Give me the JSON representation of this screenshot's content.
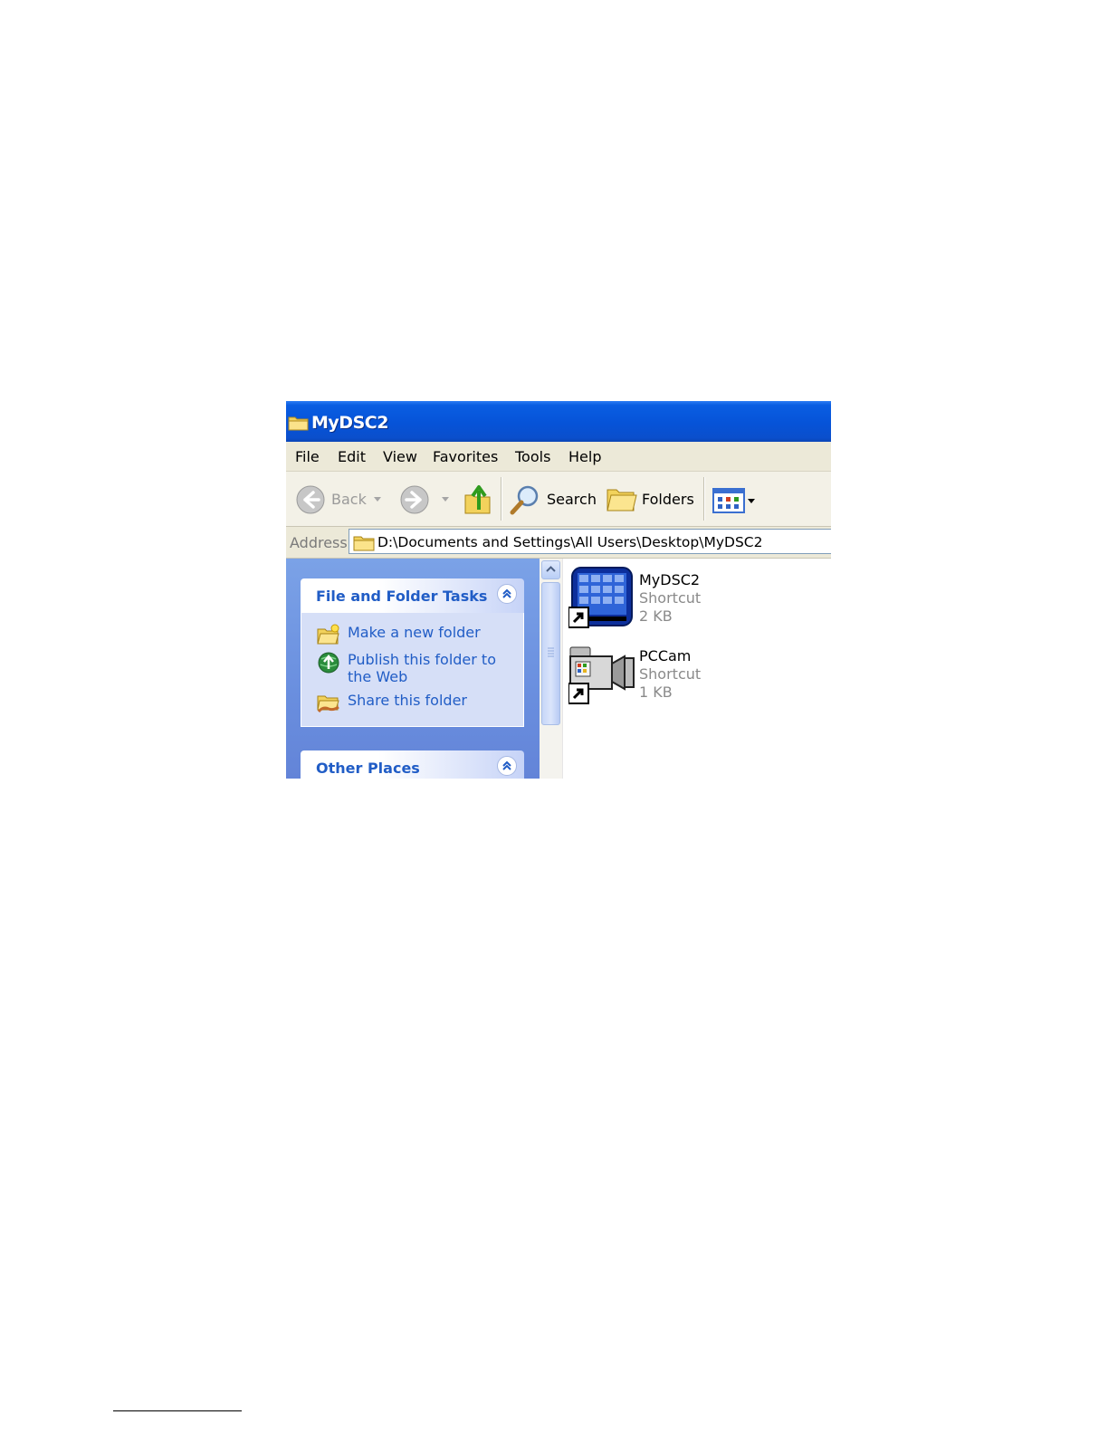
{
  "window": {
    "title": "MyDSC2"
  },
  "menu": {
    "items": [
      "File",
      "Edit",
      "View",
      "Favorites",
      "Tools",
      "Help"
    ]
  },
  "toolbar": {
    "back_label": "Back",
    "search_label": "Search",
    "folders_label": "Folders"
  },
  "address": {
    "label": "Address",
    "value": "D:\\Documents and Settings\\All Users\\Desktop\\MyDSC2"
  },
  "taskpane": {
    "file_tasks": {
      "title": "File and Folder Tasks",
      "items": [
        {
          "label": "Make a new folder",
          "icon": "new-folder-icon"
        },
        {
          "label": "Publish this folder to the Web",
          "icon": "publish-web-icon"
        },
        {
          "label": "Share this folder",
          "icon": "share-folder-icon"
        }
      ]
    },
    "other_places": {
      "title": "Other Places"
    }
  },
  "files": [
    {
      "name": "MyDSC2",
      "type": "Shortcut",
      "size": "2 KB",
      "icon": "app-grid-shortcut-icon"
    },
    {
      "name": "PCCam",
      "type": "Shortcut",
      "size": "1 KB",
      "icon": "camera-shortcut-icon"
    }
  ],
  "colors": {
    "titlebar": "#0653d8",
    "taskpane": "#6a8fdf",
    "link": "#215dc6",
    "menubar": "#ece9d8"
  }
}
